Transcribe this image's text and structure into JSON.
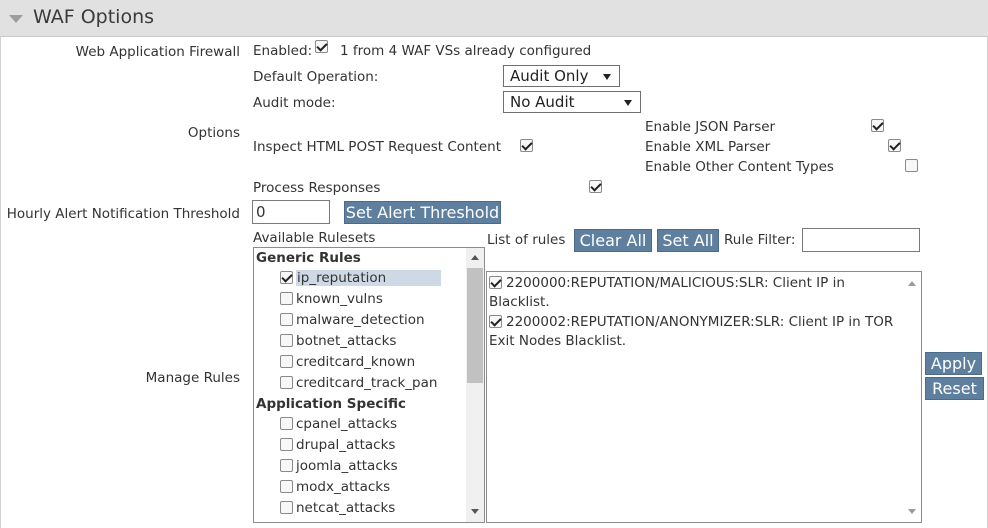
{
  "section": {
    "title": "WAF Options"
  },
  "waf": {
    "label": "Web Application Firewall",
    "enabled_label": "Enabled:",
    "enabled": true,
    "status_text": "1 from 4 WAF VSs already configured",
    "default_operation_label": "Default Operation:",
    "default_operation_value": "Audit Only",
    "audit_mode_label": "Audit mode:",
    "audit_mode_value": "No Audit"
  },
  "options": {
    "label": "Options",
    "inspect_html_post": "Inspect HTML POST Request Content",
    "enable_json": "Enable JSON Parser",
    "enable_xml": "Enable XML Parser",
    "enable_other": "Enable Other Content Types",
    "process_responses": "Process Responses"
  },
  "alert": {
    "label": "Hourly Alert Notification Threshold",
    "value": "0",
    "button": "Set Alert Threshold"
  },
  "manage": {
    "label": "Manage Rules",
    "available_label": "Available Rulesets",
    "list_label": "List of rules",
    "clear_all": "Clear All",
    "set_all": "Set All",
    "filter_label": "Rule Filter:",
    "filter_value": "",
    "apply": "Apply",
    "reset": "Reset",
    "groups": {
      "generic": "Generic Rules",
      "app": "Application Specific"
    },
    "rulesets": [
      "ip_reputation",
      "known_vulns",
      "malware_detection",
      "botnet_attacks",
      "creditcard_known",
      "creditcard_track_pan",
      "cpanel_attacks",
      "drupal_attacks",
      "joomla_attacks",
      "modx_attacks",
      "netcat_attacks"
    ],
    "rules": [
      "2200000:REPUTATION/MALICIOUS:SLR: Client IP in Blacklist.",
      "2200002:REPUTATION/ANONYMIZER:SLR: Client IP in TOR Exit Nodes Blacklist."
    ]
  }
}
